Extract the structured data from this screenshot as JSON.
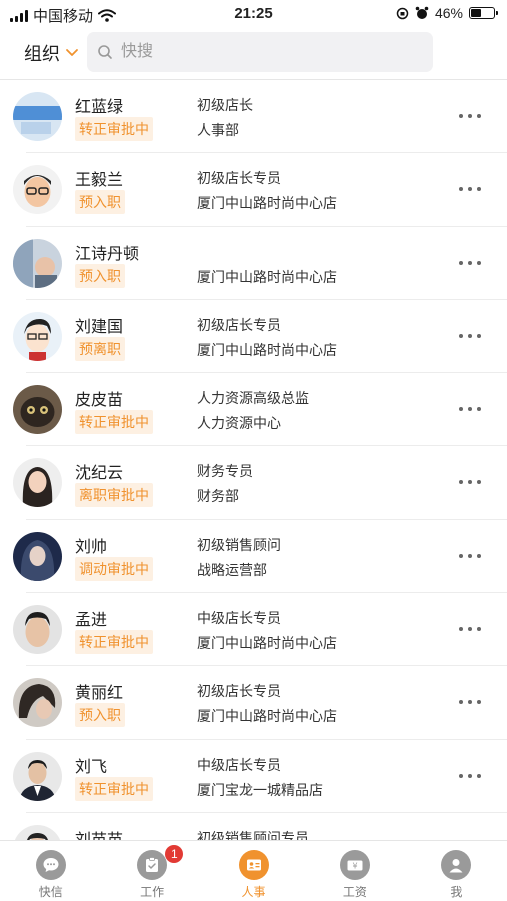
{
  "status_bar": {
    "carrier": "中国移动",
    "time": "21:25",
    "battery": "46%",
    "battery_level": 0.46
  },
  "header": {
    "org_label": "组织",
    "search_placeholder": "快搜"
  },
  "employees": [
    {
      "name": "红蓝绿",
      "status": "转正审批中",
      "position": "初级店长",
      "department": "人事部"
    },
    {
      "name": "王毅兰",
      "status": "预入职",
      "position": "初级店长专员",
      "department": "厦门中山路时尚中心店"
    },
    {
      "name": "江诗丹顿",
      "status": "预入职",
      "position": "",
      "department": "厦门中山路时尚中心店"
    },
    {
      "name": "刘建国",
      "status": "预离职",
      "position": "初级店长专员",
      "department": "厦门中山路时尚中心店"
    },
    {
      "name": "皮皮苗",
      "status": "转正审批中",
      "position": "人力资源高级总监",
      "department": "人力资源中心"
    },
    {
      "name": "沈纪云",
      "status": "离职审批中",
      "position": "财务专员",
      "department": "财务部"
    },
    {
      "name": "刘帅",
      "status": "调动审批中",
      "position": "初级销售顾问",
      "department": "战略运营部"
    },
    {
      "name": "孟进",
      "status": "转正审批中",
      "position": "中级店长专员",
      "department": "厦门中山路时尚中心店"
    },
    {
      "name": "黄丽红",
      "status": "预入职",
      "position": "初级店长专员",
      "department": "厦门中山路时尚中心店"
    },
    {
      "name": "刘飞",
      "status": "转正审批中",
      "position": "中级店长专员",
      "department": "厦门宝龙一城精品店"
    },
    {
      "name": "刘苗苗",
      "status": "",
      "position": "初级销售顾问专员",
      "department": ""
    }
  ],
  "tabs": [
    {
      "label": "快信",
      "icon": "chat-icon"
    },
    {
      "label": "工作",
      "icon": "work-icon",
      "badge": "1"
    },
    {
      "label": "人事",
      "icon": "personnel-icon",
      "active": true
    },
    {
      "label": "工资",
      "icon": "salary-icon"
    },
    {
      "label": "我",
      "icon": "me-icon"
    }
  ],
  "colors": {
    "accent": "#f0922e",
    "badge_bg": "#fdf0e2",
    "notification": "#e23a34",
    "inactive_icon": "#9a9a9a"
  }
}
